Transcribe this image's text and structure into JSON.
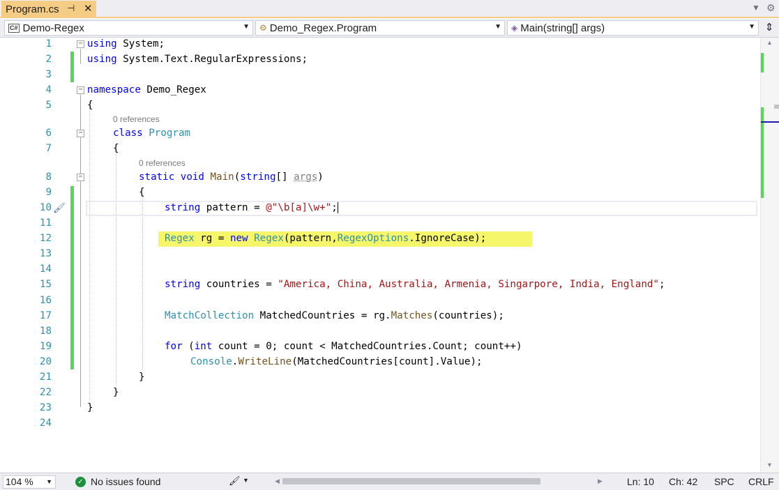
{
  "tab": {
    "title": "Program.cs",
    "pin_icon": "pin-icon",
    "close_icon": "close-icon"
  },
  "navbar": {
    "project": "Demo-Regex",
    "project_icon_label": "C#",
    "class": "Demo_Regex.Program",
    "member": "Main(string[] args)"
  },
  "editor": {
    "line_numbers": [
      "1",
      "2",
      "3",
      "4",
      "5",
      "6",
      "7",
      "8",
      "9",
      "10",
      "11",
      "12",
      "13",
      "14",
      "15",
      "16",
      "17",
      "18",
      "19",
      "20",
      "21",
      "22",
      "23",
      "24"
    ],
    "lens_class": "0 references",
    "lens_main": "0 references",
    "code": {
      "l1_kw": "using",
      "l1_rest": " System;",
      "l2_kw": "using",
      "l2_rest": " System.Text.RegularExpressions;",
      "l4_kw": "namespace",
      "l4_rest": " Demo_Regex",
      "l5": "{",
      "l6_kw": "class",
      "l6_type": "Program",
      "l7": "{",
      "l8_kw1": "static",
      "l8_kw2": "void",
      "l8_method": "Main",
      "l8_p1": "(",
      "l8_kw3": "string",
      "l8_p2": "[] ",
      "l8_param": "args",
      "l8_p3": ")",
      "l9": "{",
      "l10_kw": "string",
      "l10_mid": " pattern = ",
      "l10_str": "@\"\\b[a]\\w+\"",
      "l10_end": ";",
      "l12_type1": "Regex",
      "l12_mid1": " rg = ",
      "l12_kw": "new",
      "l12_sp": " ",
      "l12_type2": "Regex",
      "l12_mid2": "(pattern,",
      "l12_type3": "RegexOptions",
      "l12_end": ".IgnoreCase);",
      "l15_kw": "string",
      "l15_mid": " countries = ",
      "l15_str": "\"America, China, Australia, Armenia, Singarpore, India, England\"",
      "l15_end": ";",
      "l17_type": "MatchCollection",
      "l17_mid": " MatchedCountries = rg.",
      "l17_method": "Matches",
      "l17_end": "(countries);",
      "l19_kw1": "for",
      "l19_p1": " (",
      "l19_kw2": "int",
      "l19_mid": " count = 0; count < MatchedCountries.Count; count++)",
      "l20_type": "Console",
      "l20_dot": ".",
      "l20_method": "WriteLine",
      "l20_end": "(MatchedCountries[count].Value);",
      "l21": "}",
      "l22": "}",
      "l23": "}"
    }
  },
  "statusbar": {
    "zoom": "104 %",
    "issues": "No issues found",
    "line": "Ln: 10",
    "column": "Ch: 42",
    "spacing": "SPC",
    "line_ending": "CRLF"
  },
  "colors": {
    "keyword": "#0000ff",
    "type": "#2b91af",
    "string": "#a31515",
    "method": "#74531f",
    "line_number": "#2b91af",
    "change_bar": "#57d657",
    "highlight": "#f6f66a",
    "active_tab": "#f5cc84"
  }
}
